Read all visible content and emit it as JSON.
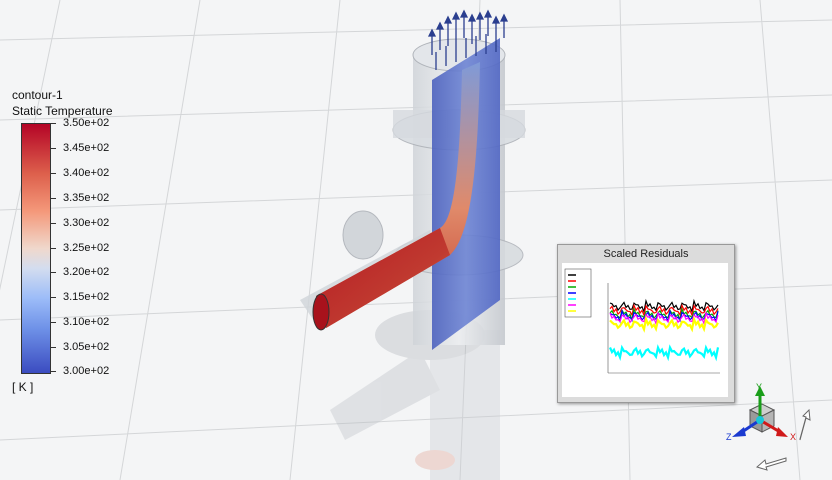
{
  "legend": {
    "title": "contour-1",
    "variable": "Static Temperature",
    "unit": "[ K ]",
    "ticks": [
      "3.50e+02",
      "3.45e+02",
      "3.40e+02",
      "3.35e+02",
      "3.30e+02",
      "3.25e+02",
      "3.20e+02",
      "3.15e+02",
      "3.10e+02",
      "3.05e+02",
      "3.00e+02"
    ],
    "colors": {
      "max": "#b40426",
      "mid": "#e8e8e8",
      "min": "#3b4cc0"
    }
  },
  "residuals": {
    "title": "Scaled Residuals",
    "series": [
      {
        "color": "#000000"
      },
      {
        "color": "#ff0000"
      },
      {
        "color": "#00aa00"
      },
      {
        "color": "#0000ff"
      },
      {
        "color": "#00ffff"
      },
      {
        "color": "#ff00ff"
      },
      {
        "color": "#ffff00"
      }
    ]
  },
  "triad": {
    "axes": [
      "Y",
      "X",
      "Z"
    ]
  }
}
